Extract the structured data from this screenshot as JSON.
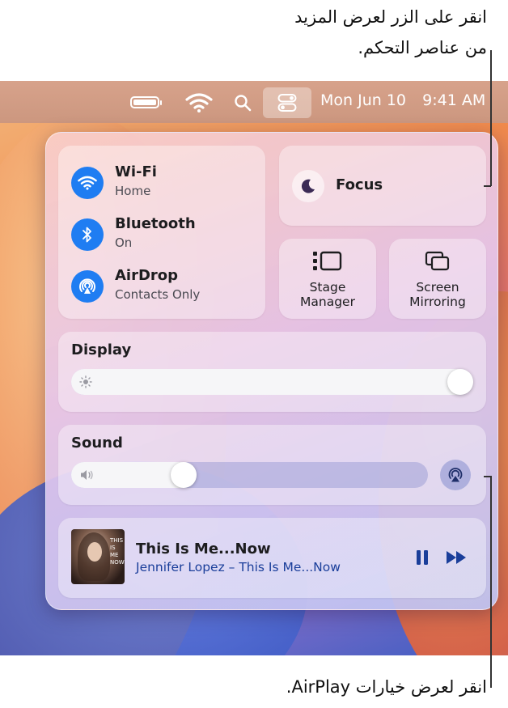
{
  "callouts": {
    "top_line1": "انقر على الزر لعرض المزيد",
    "top_line2": "من عناصر التحكم.",
    "bottom": "انقر لعرض خيارات AirPlay."
  },
  "menubar": {
    "date": "Mon Jun 10",
    "time": "9:41 AM",
    "icons": [
      "battery-icon",
      "wifi-icon",
      "search-icon",
      "control-center-icon"
    ]
  },
  "connectivity": [
    {
      "title": "Wi-Fi",
      "subtitle": "Home",
      "icon": "wifi-icon"
    },
    {
      "title": "Bluetooth",
      "subtitle": "On",
      "icon": "bluetooth-icon"
    },
    {
      "title": "AirDrop",
      "subtitle": "Contacts Only",
      "icon": "airdrop-icon"
    }
  ],
  "focus": {
    "label": "Focus",
    "icon": "moon-icon"
  },
  "stage_manager": {
    "line1": "Stage",
    "line2": "Manager"
  },
  "screen_mirroring": {
    "line1": "Screen",
    "line2": "Mirroring"
  },
  "display": {
    "title": "Display",
    "brightness": 1.0
  },
  "sound": {
    "title": "Sound",
    "volume": 0.3
  },
  "now_playing": {
    "title": "This Is Me...Now",
    "artist": "Jennifer Lopez – This Is Me...Now",
    "art_text": [
      "THIS",
      "IS",
      "ME",
      "NOW"
    ]
  },
  "colors": {
    "accent": "#1f7df2"
  }
}
